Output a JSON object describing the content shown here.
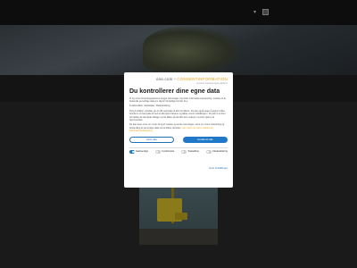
{
  "brand": {
    "name_a": "one.com",
    "plus": "+",
    "name_b": "CONSENTINFORMATION",
    "subtitle": "consent management platform"
  },
  "modal": {
    "title": "Du kontrollerer dine egne data",
    "paragraph_1": "Vi og vores forretningspartnere bruger teknologier, herunder informationsopsamling i cookies til at behandle personlige data om dig for forskellige formål, bl.a.:",
    "paragraph_2": "Funktionalitet, Statistikker, Markedsføring",
    "paragraph_3": "Hvis du klikker «Godta» gir du ditt samtykke til alle formålene. Du kan også velge å angive hvilke formål du vil samtykke til ved at afkrydse boksene og klikke «Gem indstillinger». Du kan til enhver tid trække dit samtykke tilbage ved at klikke på det lille ikon nederst i venstre hjørne af hjemmesiden.",
    "paragraph_4": "Du kan læse mere om vores brug af cookies og andre teknologier, samt om vores indsamling og behandling af personlige data ved at klikke på linket.",
    "link": "Læs mere om vores cookies og informationsindsamling",
    "btn_reject": "Afvis alle",
    "btn_accept": "Godkend alle",
    "categories": [
      {
        "label": "Nødvendige",
        "on": true
      },
      {
        "label": "Funktionelle",
        "on": false
      },
      {
        "label": "Statistikker",
        "on": false
      },
      {
        "label": "Markedsføring",
        "on": false
      }
    ],
    "save_link": "Gem indstillinger"
  }
}
